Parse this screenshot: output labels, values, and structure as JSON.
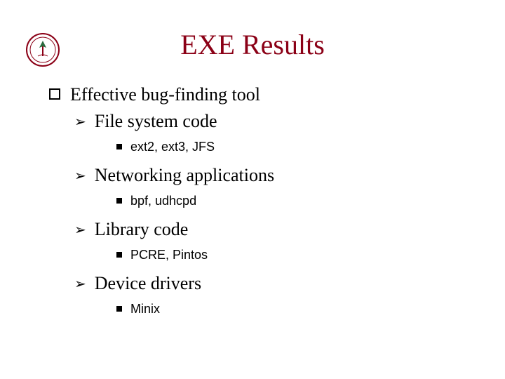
{
  "title": "EXE Results",
  "bullets": {
    "main": "Effective bug-finding tool",
    "sub1": {
      "label": "File system code",
      "detail": "ext2, ext3, JFS"
    },
    "sub2": {
      "label": "Networking applications",
      "detail": "bpf, udhcpd"
    },
    "sub3": {
      "label": "Library code",
      "detail": "PCRE, Pintos"
    },
    "sub4": {
      "label": "Device drivers",
      "detail": "Minix"
    }
  },
  "colors": {
    "accent": "#8b0016"
  }
}
